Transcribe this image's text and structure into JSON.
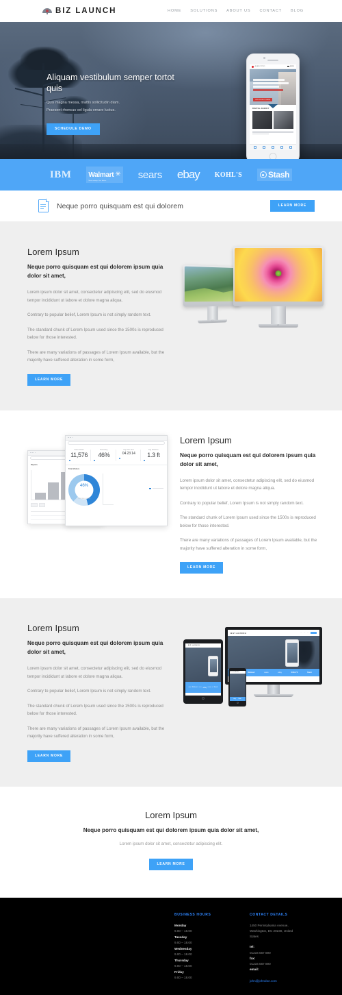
{
  "header": {
    "brand_name": "BIZ LAUNCH",
    "logo_icon": "umbrella-icon",
    "nav": [
      {
        "label": "HOME"
      },
      {
        "label": "SOLUTIONS"
      },
      {
        "label": "ABOUT US"
      },
      {
        "label": "CONTACT"
      },
      {
        "label": "BLOG"
      }
    ]
  },
  "hero": {
    "title": "Aliquam vestibulum semper tortot quis",
    "sub_line1": "Quis magna messa, mattis sollicitudin diam.",
    "sub_line2": "Praesent rhoncus vel ligula ornare luctus.",
    "cta_label": "SCHEDULE DEMO",
    "phone": {
      "site_logo": "AGENCYPRO",
      "menu_label": "MENU",
      "hero_cta": "OUR HOUSE IS HERE",
      "section_title": "DIGITAL AGENCY"
    }
  },
  "brands": {
    "items": [
      {
        "name": "IBM"
      },
      {
        "name": "Walmart",
        "tagline": "Save money. Live better."
      },
      {
        "name": "sears"
      },
      {
        "name": "ebay"
      },
      {
        "name": "KOHL'S"
      },
      {
        "name": "Stash"
      }
    ]
  },
  "callout": {
    "icon": "document-icon",
    "text": "Neque porro quisquam est qui dolorem",
    "cta_label": "LEARN MORE"
  },
  "sections": [
    {
      "heading": "Lorem Ipsum",
      "subheading": "Neque porro quisquam est qui dolorem ipsum quia dolor sit amet,",
      "paragraphs": [
        "Lorem ipsum dolor sit amet, consectetur adipiscing elit, sed do eiusmod tempor incididunt ut labore et dolore magna aliqua.",
        "Contrary to popular belief, Lorem Ipsum is not simply random text.",
        "The standard chunk of Lorem Ipsum used since the 1500s is reproduced below for those interested.",
        "There are many variations of passages of Lorem Ipsum available, but the majority have suffered alteration in some form,"
      ],
      "cta_label": "LEARN MORE",
      "media": "imac-duo-image"
    },
    {
      "heading": "Lorem Ipsum",
      "subheading": "Neque porro quisquam est qui dolorem ipsum quia dolor sit amet,",
      "paragraphs": [
        "Lorem ipsum dolor sit amet, consectetur adipiscing elit, sed do eiusmod tempor incididunt ut labore et dolore magna aliqua.",
        "Contrary to popular belief, Lorem Ipsum is not simply random text.",
        "The standard chunk of Lorem Ipsum used since the 1500s is reproduced below for those interested.",
        "There are many variations of passages of Lorem Ipsum available, but the majority have suffered alteration in some form,"
      ],
      "cta_label": "LEARN MORE",
      "media": "analytics-dashboard-image"
    },
    {
      "heading": "Lorem Ipsum",
      "subheading": "Neque porro quisquam est qui dolorem ipsum quia dolor sit amet,",
      "paragraphs": [
        "Lorem ipsum dolor sit amet, consectetur adipiscing elit, sed do eiusmod tempor incididunt ut labore et dolore magna aliqua.",
        "Contrary to popular belief, Lorem Ipsum is not simply random text.",
        "The standard chunk of Lorem Ipsum used since the 1500s is reproduced below for those interested.",
        "There are many variations of passages of Lorem Ipsum available, but the majority have suffered alteration in some form,"
      ],
      "cta_label": "LEARN MORE",
      "media": "responsive-devices-image"
    }
  ],
  "dashboard": {
    "stats": [
      {
        "label": "Total Visitors",
        "value": "11,576"
      },
      {
        "label": "Returning",
        "value": "46%"
      },
      {
        "label": "Avg Visit Time",
        "value": "04 23 14"
      },
      {
        "label": "Avg Distance",
        "value": "1.3 ft"
      }
    ],
    "panel_title": "Total Visitors",
    "donut_value": "46%",
    "donut_sub": "RETURNING VISITORS",
    "back_window_title": "Reports"
  },
  "cta": {
    "heading": "Lorem Ipsum",
    "subheading": "Neque porro quisquam est qui dolorem ipsum quia dolor sit amet,",
    "paragraph": "Lorem ipsum dolor sit amet, consectetur adipiscing elit.",
    "button_label": "LEARN MORE"
  },
  "footer": {
    "hours_heading": "BUSINESS HOURS",
    "hours": [
      {
        "day": "Monday",
        "time": "9.00 – 18.00"
      },
      {
        "day": "Tuesday",
        "time": "9.00 – 18.00"
      },
      {
        "day": "Wednesday",
        "time": "9.00 – 18.00"
      },
      {
        "day": "Thursday",
        "time": "9.00 – 18.00"
      },
      {
        "day": "Friday",
        "time": "9.00 – 18.00"
      }
    ],
    "contact_heading": "CONTACT DETAILS",
    "address_line1": "1450 Pennsylvania Avenue,",
    "address_line2": "Washington, DC 20230, United",
    "address_line3": "States",
    "tel_label": "tel:",
    "tel_value": "01234 567 890",
    "fax_label": "fax:",
    "fax_value": "01234 567 890",
    "email_label": "email:",
    "email_value": "john@johndoe.com"
  },
  "colors": {
    "accent": "#4fa6f7",
    "accent_dark": "#2f86ff",
    "hero_bg": "#4b5b70",
    "footer_bg": "#000000",
    "section_gray": "#efefef"
  }
}
